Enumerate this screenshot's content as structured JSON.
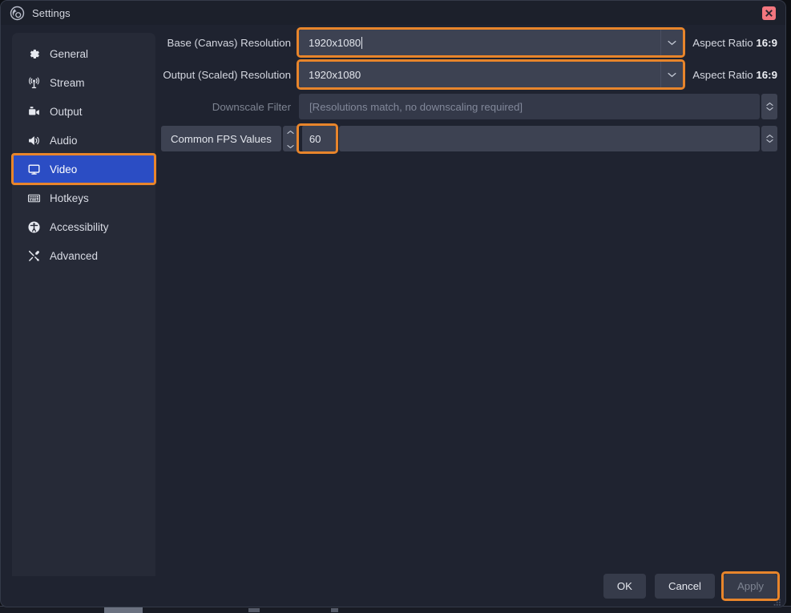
{
  "window": {
    "title": "Settings",
    "logo_icon": "obs-logo-icon",
    "close_icon": "close-icon",
    "close_label": "Close"
  },
  "sidebar": {
    "items": [
      {
        "label": "General",
        "icon": "gear-icon",
        "selected": false
      },
      {
        "label": "Stream",
        "icon": "broadcast-icon",
        "selected": false
      },
      {
        "label": "Output",
        "icon": "video-camera-icon",
        "selected": false
      },
      {
        "label": "Audio",
        "icon": "speaker-icon",
        "selected": false
      },
      {
        "label": "Video",
        "icon": "monitor-icon",
        "selected": true
      },
      {
        "label": "Hotkeys",
        "icon": "keyboard-icon",
        "selected": false
      },
      {
        "label": "Accessibility",
        "icon": "accessibility-icon",
        "selected": false
      },
      {
        "label": "Advanced",
        "icon": "tools-icon",
        "selected": false
      }
    ]
  },
  "video": {
    "base_resolution": {
      "label": "Base (Canvas) Resolution",
      "value": "1920x1080",
      "aspect_prefix": "Aspect Ratio",
      "aspect_value": "16:9",
      "highlighted": true,
      "focused": true
    },
    "output_resolution": {
      "label": "Output (Scaled) Resolution",
      "value": "1920x1080",
      "aspect_prefix": "Aspect Ratio",
      "aspect_value": "16:9",
      "highlighted": true,
      "focused": false
    },
    "downscale_filter": {
      "label": "Downscale Filter",
      "value": "[Resolutions match, no downscaling required]",
      "disabled": true
    },
    "fps": {
      "mode_label": "Common FPS Values",
      "value": "60",
      "highlighted": true
    }
  },
  "footer": {
    "ok_label": "OK",
    "cancel_label": "Cancel",
    "apply_label": "Apply",
    "apply_disabled": true,
    "apply_highlighted": true
  },
  "colors": {
    "highlight_orange": "#e8852b",
    "selection_blue": "#2b4dc4",
    "close_red": "#f2767f",
    "window_bg": "#1f2330",
    "sidebar_bg": "#262a37",
    "field_bg": "#3d4252"
  }
}
